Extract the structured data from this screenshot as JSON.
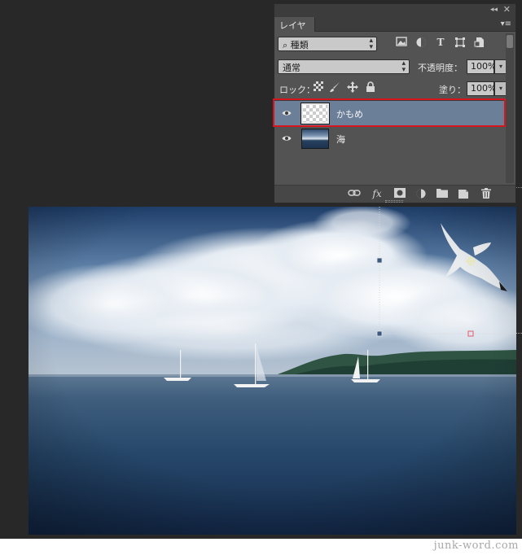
{
  "layers_panel": {
    "tab_label": "レイヤー",
    "collapse_glyph": "◂◂",
    "close_glyph": "✕",
    "menu_glyph": "▾≡",
    "filter": {
      "search_glyph": "⌕",
      "kind_label": "種類",
      "icons": [
        "image-filter-icon",
        "adjustment-filter-icon",
        "type-filter-icon",
        "shape-filter-icon",
        "smart-object-filter-icon"
      ]
    },
    "blend_mode": "通常",
    "opacity_label": "不透明度：",
    "opacity_value": "100%",
    "lock_label": "ロック：",
    "fill_label": "塗り：",
    "fill_value": "100%",
    "layers": [
      {
        "name": "かもめ",
        "selected": true,
        "visible": true,
        "thumbnail": "transparent"
      },
      {
        "name": "海",
        "selected": false,
        "visible": true,
        "thumbnail": "sea-photo"
      }
    ],
    "footer_icons": [
      "link-layers-icon",
      "fx-icon",
      "layer-mask-icon",
      "adjustment-layer-icon",
      "group-folder-icon",
      "new-layer-icon",
      "trash-icon"
    ],
    "fx_label": "fx"
  },
  "canvas": {
    "description_free": true
  },
  "colors": {
    "app_bg": "#282828",
    "panel_bg": "#535353",
    "selected_layer": "#6c7f99",
    "highlight_outline": "#d8141c"
  },
  "watermark": "junk-word.com"
}
